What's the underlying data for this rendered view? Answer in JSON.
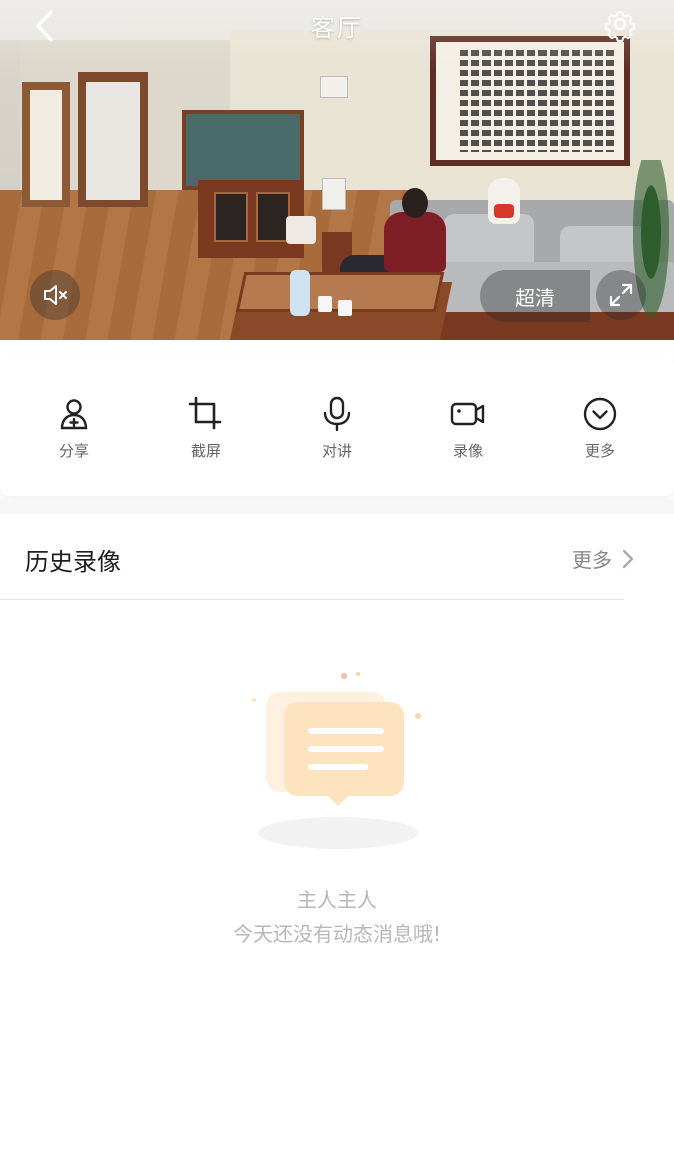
{
  "header": {
    "title": "客厅",
    "back_icon": "chevron-left-icon",
    "settings_icon": "gear-icon"
  },
  "video": {
    "mute_icon": "speaker-muted-icon",
    "quality_label": "超清",
    "fullscreen_icon": "expand-icon"
  },
  "toolbar": {
    "items": [
      {
        "label": "分享",
        "icon": "share-user-icon"
      },
      {
        "label": "截屏",
        "icon": "crop-icon"
      },
      {
        "label": "对讲",
        "icon": "microphone-icon"
      },
      {
        "label": "录像",
        "icon": "video-camera-icon"
      },
      {
        "label": "更多",
        "icon": "chevron-down-circle-icon"
      }
    ]
  },
  "history": {
    "title": "历史录像",
    "more_label": "更多",
    "empty_line1": "主人主人",
    "empty_line2": "今天还没有动态消息哦!"
  },
  "colors": {
    "accent": "#f5a623",
    "illustration_light": "#fde9c9",
    "text_muted": "#b7b7b7"
  }
}
